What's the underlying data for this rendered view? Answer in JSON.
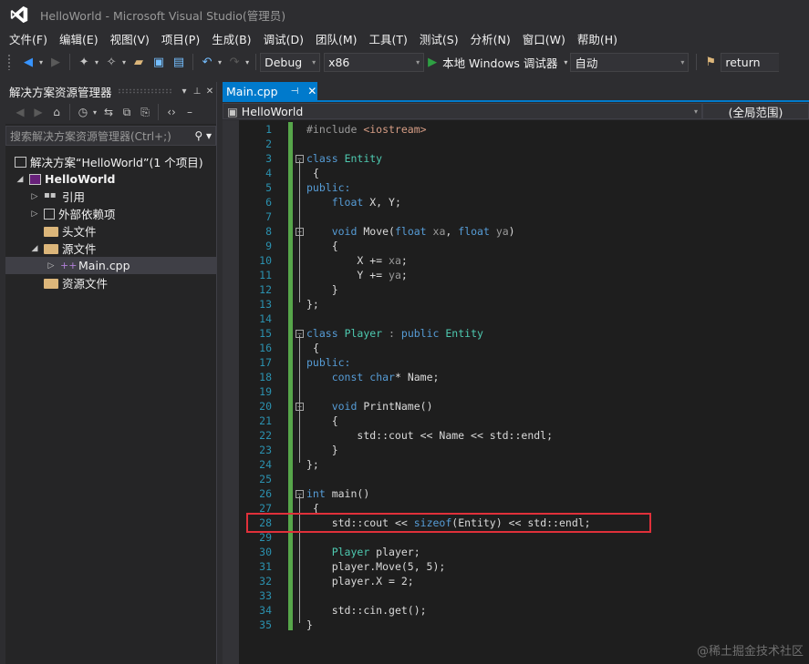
{
  "window": {
    "title": "HelloWorld - Microsoft Visual Studio(管理员)"
  },
  "menu": [
    "文件(F)",
    "编辑(E)",
    "视图(V)",
    "项目(P)",
    "生成(B)",
    "调试(D)",
    "团队(M)",
    "工具(T)",
    "测试(S)",
    "分析(N)",
    "窗口(W)",
    "帮助(H)"
  ],
  "toolbar": {
    "config": "Debug",
    "platform": "x86",
    "run_label": "本地 Windows 调试器",
    "auto_label": "自动",
    "find_value": "return"
  },
  "solution_explorer": {
    "title": "解决方案资源管理器",
    "search_placeholder": "搜索解决方案资源管理器(Ctrl+;)",
    "tree": [
      {
        "label": "解决方案“HelloWorld”(1 个项目)"
      },
      {
        "label": "HelloWorld"
      },
      {
        "label": "引用"
      },
      {
        "label": "外部依赖项"
      },
      {
        "label": "头文件"
      },
      {
        "label": "源文件"
      },
      {
        "label": "Main.cpp"
      },
      {
        "label": "资源文件"
      }
    ]
  },
  "editor": {
    "tab_label": "Main.cpp",
    "nav_scope": "HelloWorld",
    "nav_member": "(全局范围)",
    "lines": [
      "1",
      "2",
      "3",
      "4",
      "5",
      "6",
      "7",
      "8",
      "9",
      "10",
      "11",
      "12",
      "13",
      "14",
      "15",
      "16",
      "17",
      "18",
      "19",
      "20",
      "21",
      "22",
      "23",
      "24",
      "25",
      "26",
      "27",
      "28",
      "29",
      "30",
      "31",
      "32",
      "33",
      "34",
      "35"
    ],
    "code_text": {
      "l1_dir": "#include",
      "l1_hdr": " <iostream>",
      "class": "class",
      "entity": "Entity",
      "player": "Player",
      "colon": " : ",
      "public_kw": "public",
      "public_label": "public:",
      "float": "float",
      "xy": " X, Y;",
      "void": "void",
      "move": "Move(",
      "xa": "xa",
      "comma": ", ",
      "ya": "ya",
      "close_paren": ")",
      "open_brace": "{",
      "close_brace": "}",
      "class_end": "};",
      "x_plus": "X += ",
      "y_plus": "Y += ",
      "semi": ";",
      "const": "const",
      "char": "char",
      "name_decl": "* Name;",
      "printname": "PrintName()",
      "cout_name": "std::cout << Name << std::endl;",
      "int": "int",
      "main": " main()",
      "l28_pre": "std::cout << ",
      "sizeof": "sizeof",
      "l28_post": "(Entity) << std::endl;",
      "player_decl": " player;",
      "player_move": "player.Move(5, 5);",
      "player_x": "player.X = 2;",
      "cin_get": "std::cin.get();"
    }
  },
  "watermark": "@稀土掘金技术社区"
}
